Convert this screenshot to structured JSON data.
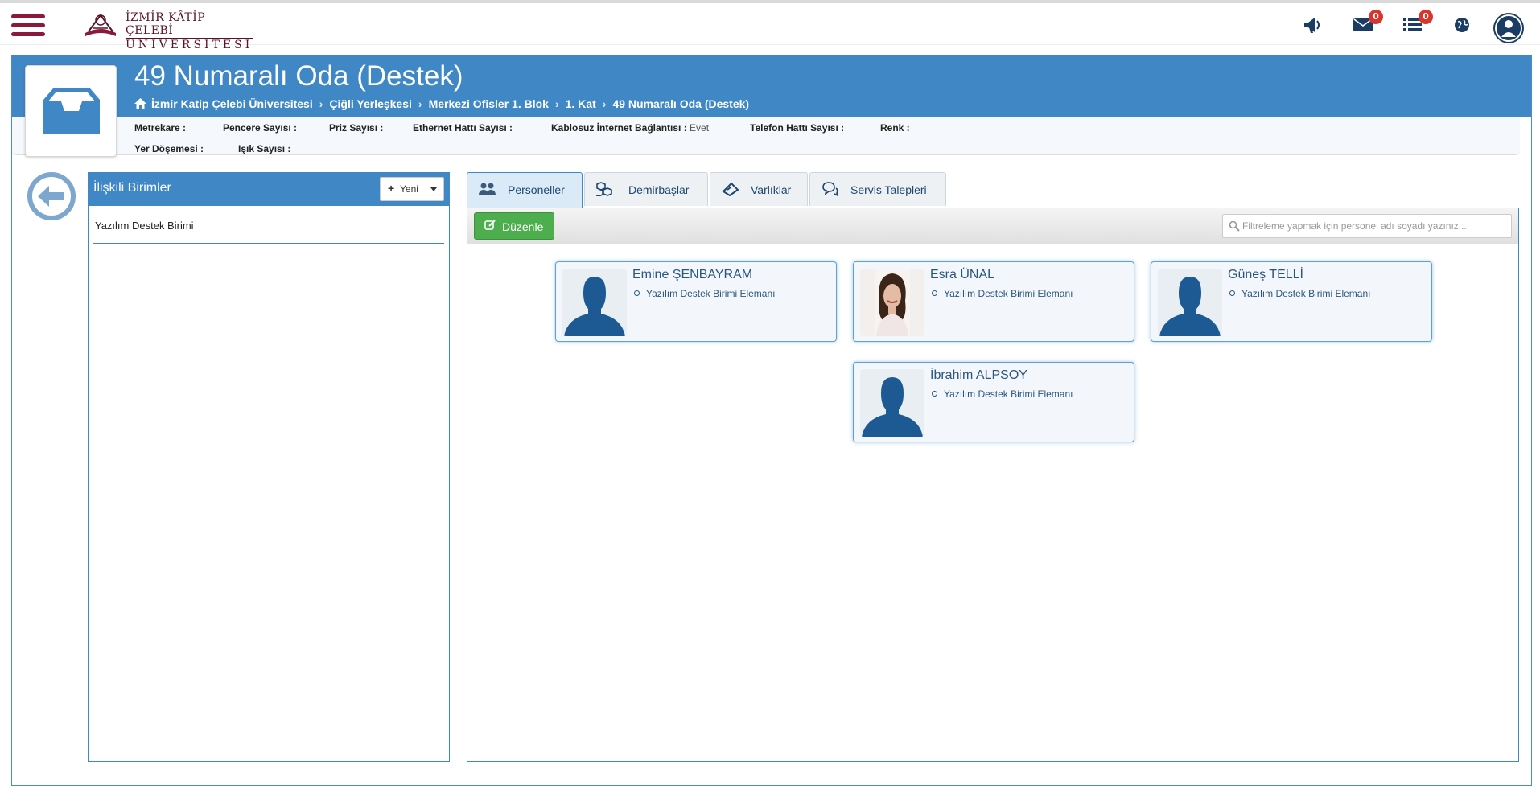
{
  "topbar": {
    "logo_line1": "İZMİR KÂTİP ÇELEBİ",
    "logo_line2": "ÜNİVERSİTESİ",
    "messages_badge": "0",
    "tasks_badge": "0"
  },
  "room": {
    "title": "49 Numaralı Oda (Destek)",
    "breadcrumb": [
      "İzmir Katip Çelebi Üniversitesi",
      "Çiğli Yerleşkesi",
      "Merkezi Ofisler 1. Blok",
      "1. Kat",
      "49 Numaralı Oda (Destek)"
    ],
    "properties": [
      {
        "label": "Metrekare :",
        "value": ""
      },
      {
        "label": "Pencere Sayısı :",
        "value": ""
      },
      {
        "label": "Priz Sayısı :",
        "value": ""
      },
      {
        "label": "Ethernet Hattı Sayısı :",
        "value": ""
      },
      {
        "label": "Kablosuz İnternet Bağlantısı :",
        "value": "Evet"
      },
      {
        "label": "Telefon Hattı Sayısı :",
        "value": ""
      },
      {
        "label": "Renk :",
        "value": ""
      },
      {
        "label": "Yer Döşemesi :",
        "value": ""
      },
      {
        "label": "Işık Sayısı :",
        "value": ""
      }
    ]
  },
  "related_units": {
    "title": "İlişkili Birimler",
    "new_label": "Yeni",
    "items": [
      "Yazılım Destek Birimi"
    ]
  },
  "tabs": [
    {
      "label": "Personeller",
      "icon": "users-icon"
    },
    {
      "label": "Demirbaşlar",
      "icon": "cubes-icon"
    },
    {
      "label": "Varlıklar",
      "icon": "ticket-icon"
    },
    {
      "label": "Servis Talepleri",
      "icon": "comments-icon"
    }
  ],
  "personnel": {
    "edit_label": "Düzenle",
    "filter_placeholder": "Filtreleme yapmak için personel adı soyadı yazınız...",
    "people": [
      {
        "name": "Emine ŞENBAYRAM",
        "role": "Yazılım Destek Birimi Elemanı",
        "photo": "silhouette"
      },
      {
        "name": "Esra ÜNAL",
        "role": "Yazılım Destek Birimi Elemanı",
        "photo": "portrait"
      },
      {
        "name": "Güneş TELLİ",
        "role": "Yazılım Destek Birimi Elemanı",
        "photo": "silhouette"
      },
      {
        "name": "İbrahim ALPSOY",
        "role": "Yazılım Destek Birimi Elemanı",
        "photo": "silhouette"
      }
    ]
  },
  "colors": {
    "primary": "#3f88c5",
    "brand": "#8b1a3a",
    "success": "#4cae4c",
    "badge": "#d9352c"
  }
}
